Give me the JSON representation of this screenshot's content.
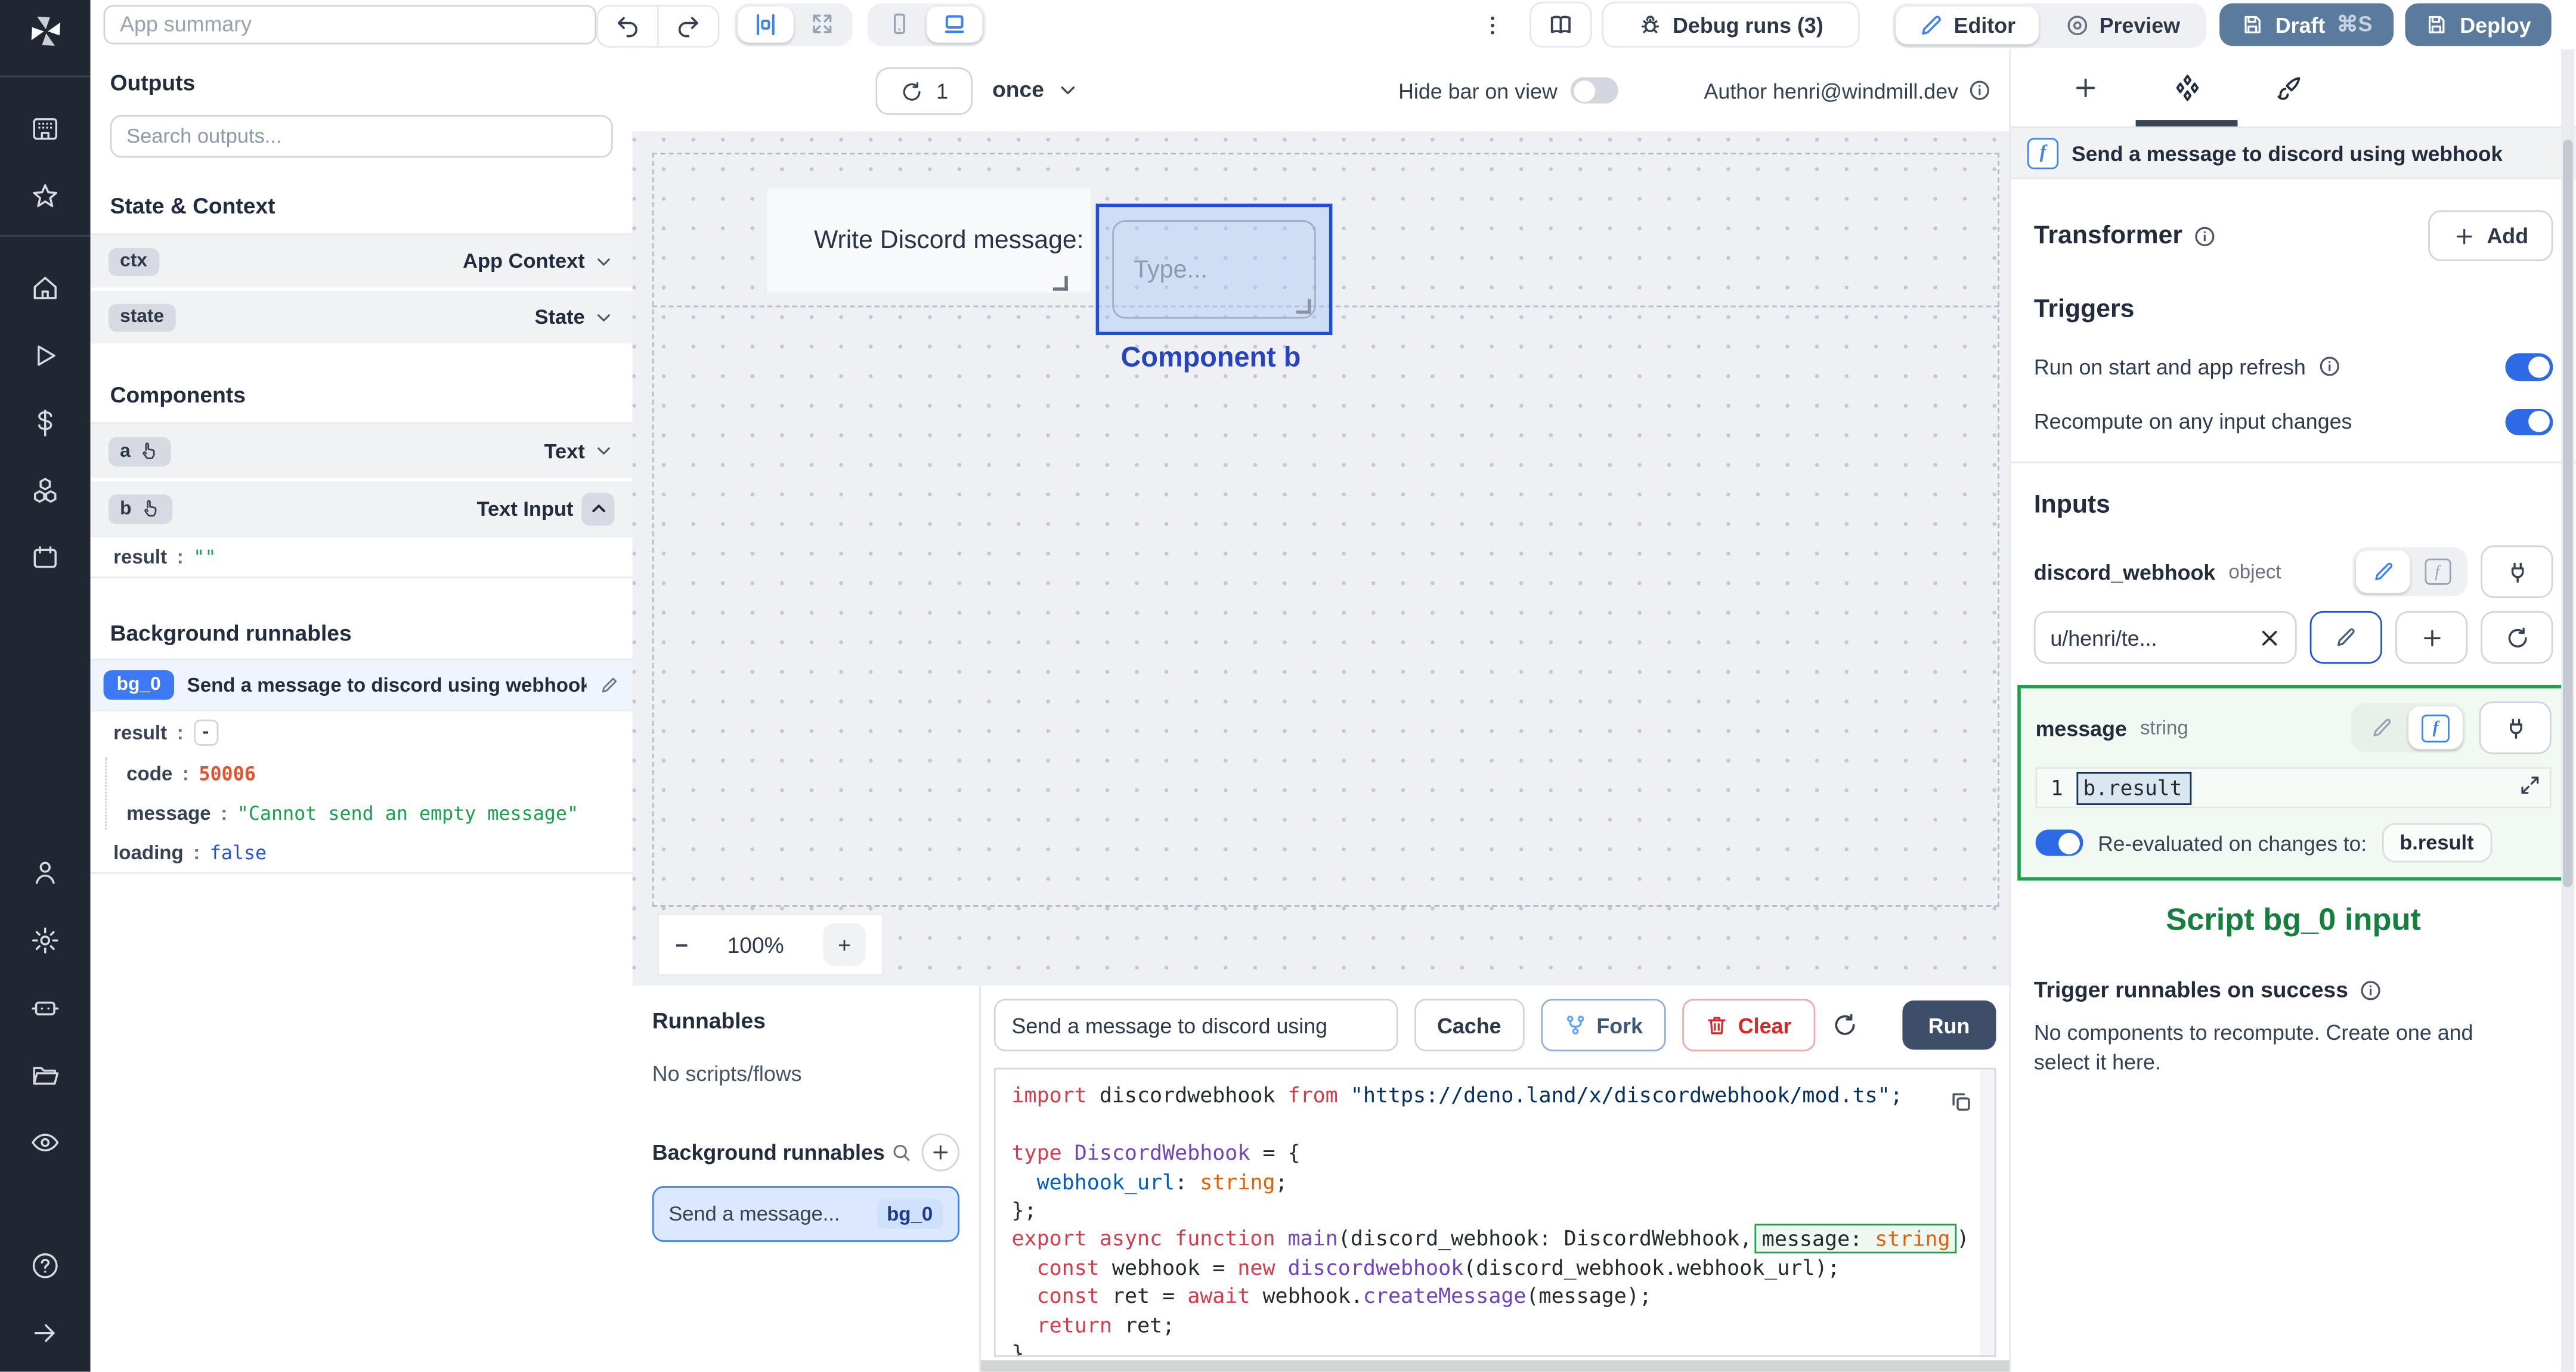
{
  "topbar": {
    "app_summary_placeholder": "App summary",
    "debug_runs_label": "Debug runs (3)",
    "editor_label": "Editor",
    "preview_label": "Preview",
    "draft_label": "Draft",
    "draft_shortcut": "⌘S",
    "deploy_label": "Deploy"
  },
  "canvasbar": {
    "refresh_count": "1",
    "interval": "once",
    "hide_bar_label": "Hide bar on view",
    "author_label": "Author henri@windmill.dev"
  },
  "canvas": {
    "text_label": "Write Discord message:",
    "input_placeholder": "Type...",
    "component_label": "Component b",
    "zoom_level": "100%",
    "zoom_minus": "−",
    "zoom_plus": "+"
  },
  "left": {
    "outputs_title": "Outputs",
    "search_placeholder": "Search outputs...",
    "state_context_title": "State & Context",
    "state_rows": [
      {
        "key": "ctx",
        "type": "App Context"
      },
      {
        "key": "state",
        "type": "State"
      }
    ],
    "components_title": "Components",
    "component_rows": [
      {
        "key": "a",
        "type": "Text"
      },
      {
        "key": "b",
        "type": "Text Input"
      }
    ],
    "b_result": {
      "key": "result",
      "value": "\"\""
    },
    "bg_title": "Background runnables",
    "bg_badge": "bg_0",
    "bg_name": "Send a message to discord using webhook",
    "bg_rows": [
      {
        "key": "result",
        "value": "-"
      },
      {
        "key": "code",
        "value": "50006"
      },
      {
        "key": "message",
        "value": "\"Cannot send an empty message\""
      },
      {
        "key": "loading",
        "value": "false"
      }
    ]
  },
  "bottom": {
    "runnables_title": "Runnables",
    "no_scripts": "No scripts/flows",
    "bg_title": "Background runnables",
    "item_name": "Send a message...",
    "item_badge": "bg_0",
    "script_name": "Send a message to discord using",
    "cache_label": "Cache",
    "fork_label": "Fork",
    "clear_label": "Clear",
    "run_label": "Run"
  },
  "code": {
    "lines": [
      {
        "segs": [
          [
            "import",
            "k"
          ],
          [
            " discordwebhook ",
            "t"
          ],
          [
            "from",
            "k"
          ],
          [
            " ",
            "t"
          ],
          [
            "\"https://deno.land/x/discordwebhook/mod.ts\";",
            "s"
          ]
        ]
      },
      {
        "segs": []
      },
      {
        "segs": [
          [
            "type",
            "k"
          ],
          [
            " ",
            "t"
          ],
          [
            "DiscordWebhook",
            "p"
          ],
          [
            " = {",
            "t"
          ]
        ]
      },
      {
        "segs": [
          [
            "  ",
            "t"
          ],
          [
            "webhook_url",
            "b"
          ],
          [
            ": ",
            "t"
          ],
          [
            "string",
            "o"
          ],
          [
            ";",
            "t"
          ]
        ]
      },
      {
        "segs": [
          [
            "};",
            "t"
          ]
        ]
      },
      {
        "segs": [
          [
            "export",
            "k"
          ],
          [
            " ",
            "t"
          ],
          [
            "async",
            "k"
          ],
          [
            " ",
            "t"
          ],
          [
            "function",
            "k"
          ],
          [
            " ",
            "t"
          ],
          [
            "main",
            "p"
          ],
          [
            "(discord_webhook: DiscordWebhook,",
            "t"
          ]
        ],
        "box": [
          [
            "message: ",
            "t"
          ],
          [
            "string",
            "o"
          ]
        ],
        "after": [
          [
            ") {",
            "t"
          ]
        ]
      },
      {
        "segs": [
          [
            "  ",
            "t"
          ],
          [
            "const",
            "k"
          ],
          [
            " webhook = ",
            "t"
          ],
          [
            "new",
            "k"
          ],
          [
            " ",
            "t"
          ],
          [
            "discordwebhook",
            "p"
          ],
          [
            "(discord_webhook.webhook_url);",
            "t"
          ]
        ]
      },
      {
        "segs": [
          [
            "  ",
            "t"
          ],
          [
            "const",
            "k"
          ],
          [
            " ret = ",
            "t"
          ],
          [
            "await",
            "k"
          ],
          [
            " webhook.",
            "t"
          ],
          [
            "createMessage",
            "p"
          ],
          [
            "(message);",
            "t"
          ]
        ]
      },
      {
        "segs": [
          [
            "  ",
            "t"
          ],
          [
            "return",
            "k"
          ],
          [
            " ret;",
            "t"
          ]
        ]
      },
      {
        "segs": [
          [
            "}",
            "t"
          ]
        ]
      }
    ]
  },
  "right": {
    "script_title": "Send a message to discord using webhook",
    "transformer_title": "Transformer",
    "add_label": "Add",
    "triggers_title": "Triggers",
    "run_on_start": "Run on start and app refresh",
    "recompute": "Recompute on any input changes",
    "inputs_title": "Inputs",
    "field1": {
      "name": "discord_webhook",
      "type": "object",
      "value": "u/henri/te..."
    },
    "field2": {
      "name": "message",
      "type": "string",
      "line_no": "1",
      "expr": "b.result",
      "reeval_label": "Re-evaluated on changes to:",
      "reeval_target": "b.result"
    },
    "script_input_label": "Script bg_0 input",
    "trigger_on_success": "Trigger runnables on success",
    "no_components": "No components to recompute. Create one and select it here."
  },
  "rail_icons": [
    "windmill-logo",
    "apps",
    "star",
    "home",
    "play",
    "dollar",
    "cubes",
    "calendar",
    "user",
    "gear",
    "robot",
    "folder",
    "eye",
    "help",
    "arrow-right"
  ],
  "colors": {
    "accent_blue": "#3b82f6",
    "toggle_on": "#2d6ae5",
    "selection_blue": "#1d4fd8",
    "green_border": "#16a34a",
    "green_text": "#15803d",
    "steel_button": "#5b7b9d",
    "run_button": "#3e4e68",
    "code_keyword": "#d73a49",
    "code_type": "#6f42c1",
    "code_property": "#005cc5",
    "code_builtin": "#e36209",
    "code_string": "#032f62",
    "value_orange": "#e4532e",
    "value_green": "#16a34a",
    "value_blue": "#2550e0",
    "rail_bg": "#212633"
  }
}
